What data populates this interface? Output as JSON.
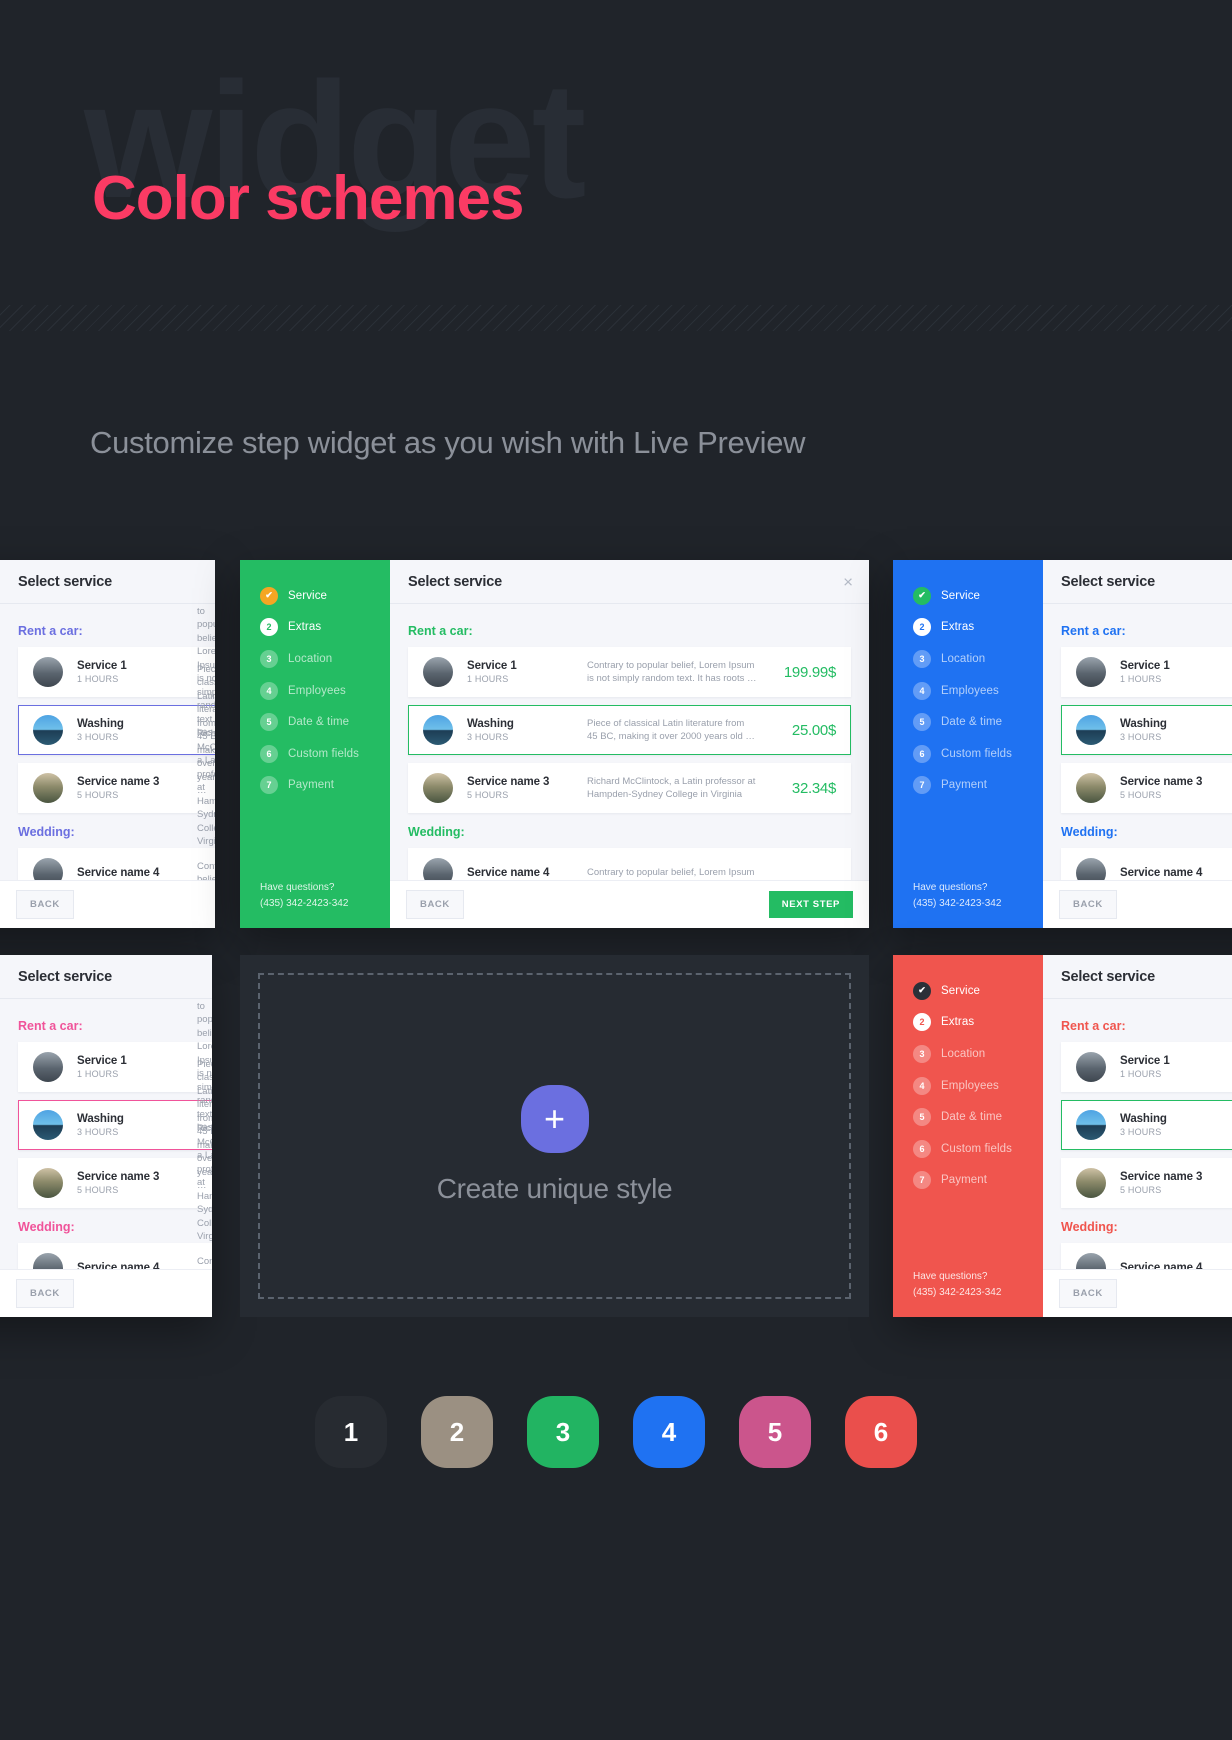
{
  "hero": {
    "ghost_word": "widget",
    "title": "Color schemes",
    "accent": "#fb3b64"
  },
  "subtitle": "Customize step widget as you wish with Live Preview",
  "widget": {
    "head_title": "Select service",
    "close_icon": "×",
    "groups": [
      {
        "label": "Rent a car:"
      },
      {
        "label": "Wedding:"
      }
    ],
    "steps": [
      {
        "num": "✔",
        "label": "Service",
        "state": "done"
      },
      {
        "num": "2",
        "label": "Extras",
        "state": "active"
      },
      {
        "num": "3",
        "label": "Location",
        "state": "todo"
      },
      {
        "num": "4",
        "label": "Employees",
        "state": "todo"
      },
      {
        "num": "5",
        "label": "Date & time",
        "state": "todo"
      },
      {
        "num": "6",
        "label": "Custom fields",
        "state": "todo"
      },
      {
        "num": "7",
        "label": "Payment",
        "state": "todo"
      }
    ],
    "services": [
      {
        "name": "Service 1",
        "duration": "1 HOURS",
        "desc_line1": "Contrary to popular belief, Lorem Ipsum",
        "desc_line2": "is not simply random text. It has roots …",
        "price": "199.99$"
      },
      {
        "name": "Washing",
        "duration": "3 HOURS",
        "desc_line1": "Piece of classical Latin literature from",
        "desc_line2": "45 BC, making it over 2000 years old …",
        "price": "25.00$"
      },
      {
        "name": "Service name 3",
        "duration": "5 HOURS",
        "desc_line1": "Richard McClintock, a Latin professor at",
        "desc_line2": "Hampden-Sydney College in Virginia",
        "price": "32.34$"
      },
      {
        "name": "Service name 4",
        "duration": "",
        "desc_line1": "Contrary to popular belief, Lorem Ipsum",
        "desc_line2": "",
        "price": ""
      }
    ],
    "support": {
      "question": "Have questions?",
      "phone": "(435) 342-2423-342"
    },
    "buttons": {
      "back": "BACK",
      "next": "NEXT STEP"
    }
  },
  "themes": {
    "indigo": {
      "accent": "#6b6fe0",
      "sidebar": "#6b6fe0",
      "price": "#6b6fe0"
    },
    "green": {
      "accent": "#24bc63",
      "sidebar": "#24bc63",
      "price": "#24bc63"
    },
    "blue": {
      "accent": "#1f72f2",
      "sidebar": "#1f72f2",
      "price": "#24bc63"
    },
    "pink": {
      "accent": "#f0549a",
      "sidebar": "#f0549a",
      "price": "#f0549a"
    },
    "red": {
      "accent": "#f0554e",
      "sidebar": "#f0554e",
      "price": "#24bc63"
    }
  },
  "create": {
    "plus_icon": "+",
    "label": "Create unique style"
  },
  "swatches": [
    {
      "num": "1",
      "color": "#272b31"
    },
    {
      "num": "2",
      "color": "#9b9082"
    },
    {
      "num": "3",
      "color": "#22b462"
    },
    {
      "num": "4",
      "color": "#1f72f2"
    },
    {
      "num": "5",
      "color": "#cb558c"
    },
    {
      "num": "6",
      "color": "#ea4f4c"
    }
  ]
}
